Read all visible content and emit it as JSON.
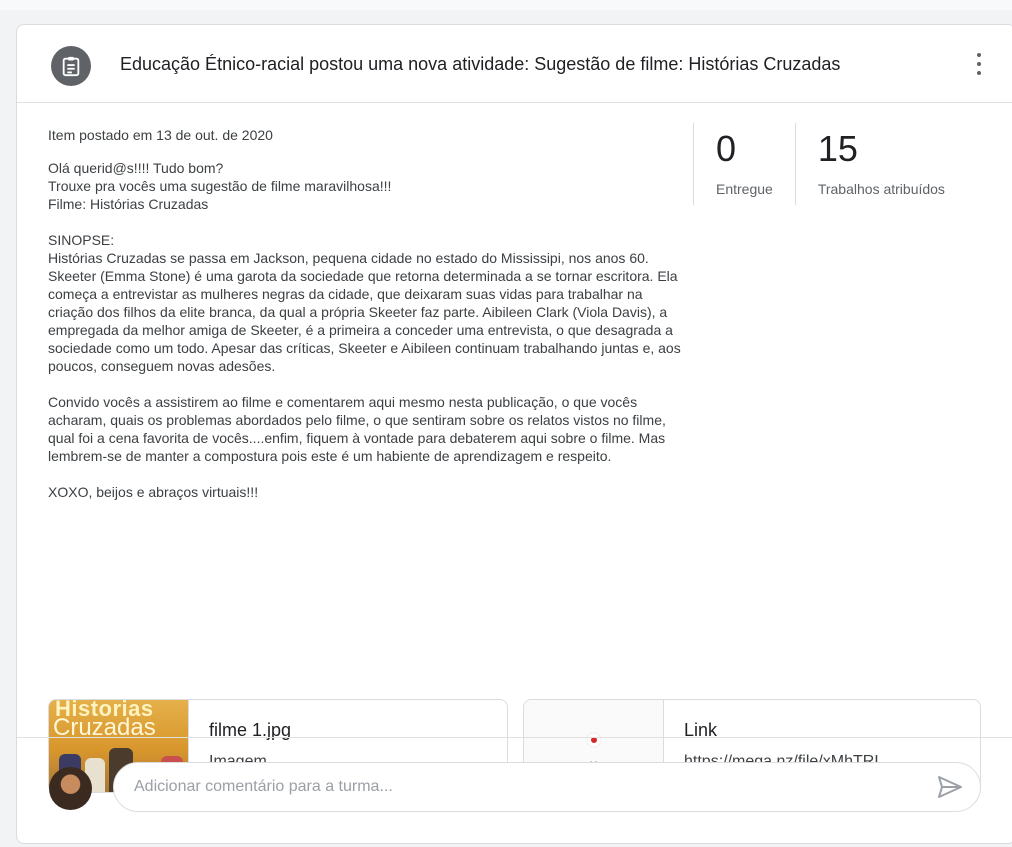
{
  "header": {
    "title": "Educação Étnico-racial postou uma nova atividade: Sugestão de filme: Histórias Cruzadas",
    "icon": "assignment-icon"
  },
  "post": {
    "posted_date": "Item postado em 13 de out. de 2020",
    "text": "Olá querid@s!!!! Tudo bom?\nTrouxe pra vocês uma sugestão de filme maravilhosa!!!\nFilme: Histórias Cruzadas\n\nSINOPSE:\nHistórias Cruzadas se passa em Jackson, pequena cidade no estado do Mississipi, nos anos 60. Skeeter (Emma Stone) é uma garota da sociedade que retorna determinada a se tornar escritora. Ela começa a entrevistar as mulheres negras da cidade, que deixaram suas vidas para trabalhar na criação dos filhos da elite branca, da qual a própria Skeeter faz parte. Aibileen Clark (Viola Davis), a empregada da melhor amiga de Skeeter, é a primeira a conceder uma entrevista, o que desagrada a sociedade como um todo. Apesar das críticas, Skeeter e Aibileen continuam trabalhando juntas e, aos poucos, conseguem novas adesões.\n\nConvido vocês a assistirem ao filme e comentarem aqui mesmo nesta publicação, o que vocês acharam, quais os problemas abordados pelo filme, o que sentiram sobre os relatos vistos no filme, qual foi a cena favorita de vocês....enfim, fiquem à vontade para debaterem aqui sobre o filme. Mas lembrem-se de manter a compostura pois este é um habiente de aprendizagem e respeito.\n\nXOXO, beijos e abraços virtuais!!!"
  },
  "stats": {
    "delivered": {
      "value": "0",
      "label": "Entregue"
    },
    "assigned": {
      "value": "15",
      "label": "Trabalhos atribuídos"
    }
  },
  "attachments": [
    {
      "name": "filme 1.jpg",
      "type": "Imagem",
      "thumb_text_line1": "Historias",
      "thumb_text_line2": "Cruzadas"
    },
    {
      "name": "Link",
      "type": "https://mega.nz/file/xMhTRI..."
    }
  ],
  "comment": {
    "placeholder": "Adicionar comentário para a turma..."
  },
  "colors": {
    "header_icon_bg": "#5f6368",
    "send_icon": "#9aa0a6"
  }
}
